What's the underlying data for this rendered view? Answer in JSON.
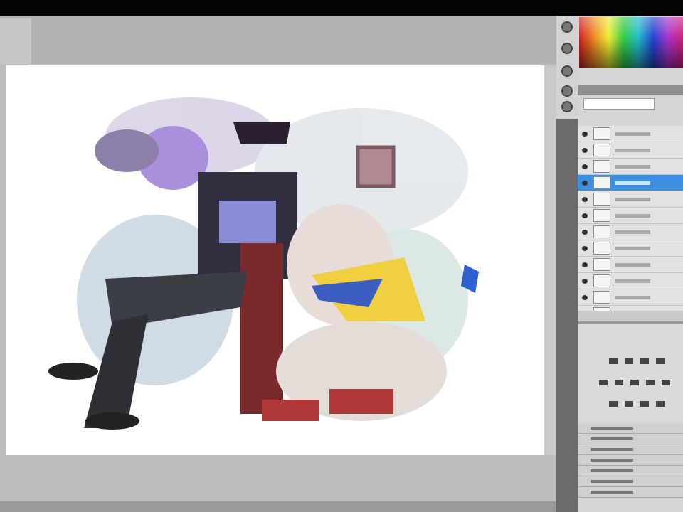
{
  "window": {
    "app": "image editor"
  },
  "colors": {
    "selection": "#3d8fe0",
    "canvas": "#ffffff",
    "workspace": "#bdbdbd"
  },
  "layers": {
    "count": 12,
    "selected_index": 3
  },
  "adjustments": {
    "rows": 7
  }
}
